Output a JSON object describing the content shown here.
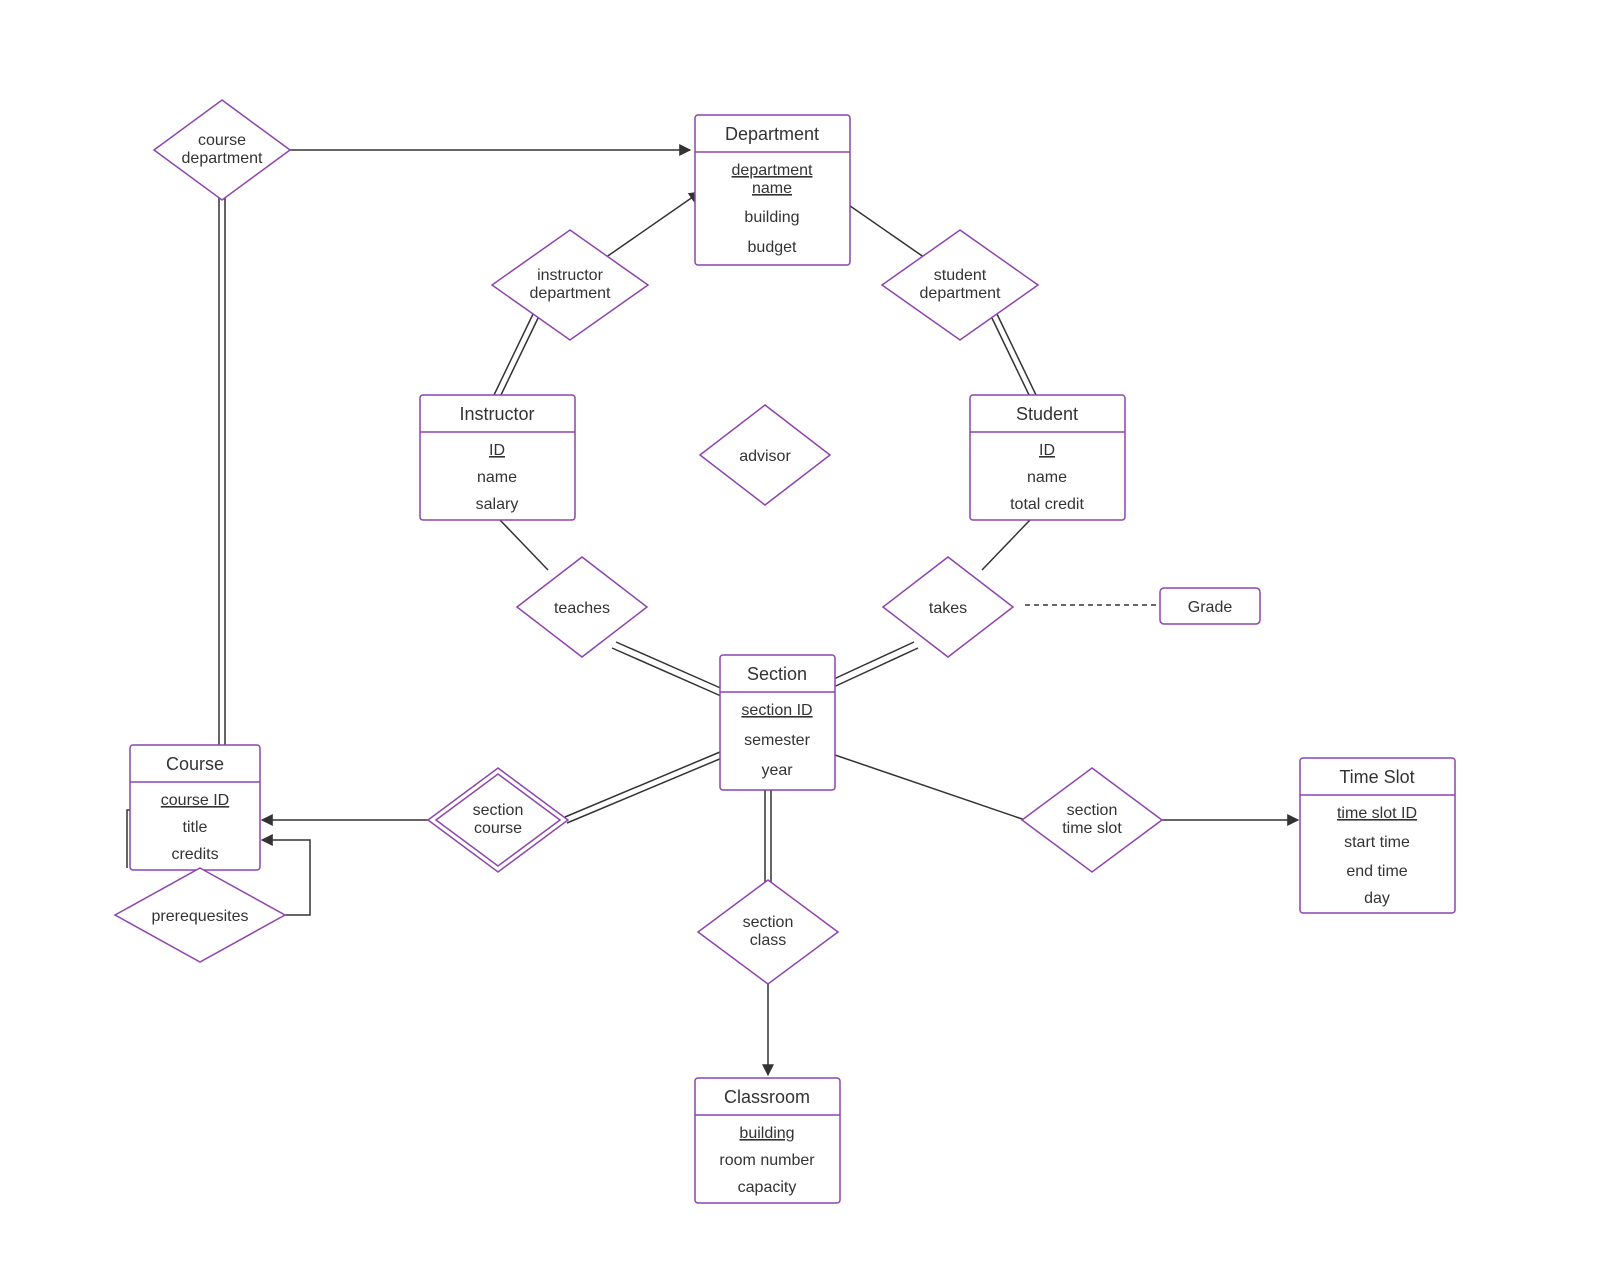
{
  "entities": {
    "department": {
      "title": "Department",
      "attrs": [
        "department name",
        "building",
        "budget"
      ],
      "key": 0
    },
    "instructor": {
      "title": "Instructor",
      "attrs": [
        "ID",
        "name",
        "salary"
      ],
      "key": 0
    },
    "student": {
      "title": "Student",
      "attrs": [
        "ID",
        "name",
        "total credit"
      ],
      "key": 0
    },
    "section": {
      "title": "Section",
      "attrs": [
        "section ID",
        "semester",
        "year"
      ],
      "key": 0
    },
    "course": {
      "title": "Course",
      "attrs": [
        "course ID",
        "title",
        "credits"
      ],
      "key": 0
    },
    "classroom": {
      "title": "Classroom",
      "attrs": [
        "building",
        "room number",
        "capacity"
      ],
      "key": 0
    },
    "timeslot": {
      "title": "Time Slot",
      "attrs": [
        "time slot ID",
        "start time",
        "end time",
        "day"
      ],
      "key": 0
    }
  },
  "relationships": {
    "course_department": "course department",
    "instructor_department": "instructor department",
    "student_department": "student department",
    "advisor": "advisor",
    "teaches": "teaches",
    "takes": "takes",
    "section_course": "section course",
    "section_timeslot": "section time slot",
    "section_class": "section class",
    "prerequisites": "prerequesites",
    "grade": "Grade"
  }
}
